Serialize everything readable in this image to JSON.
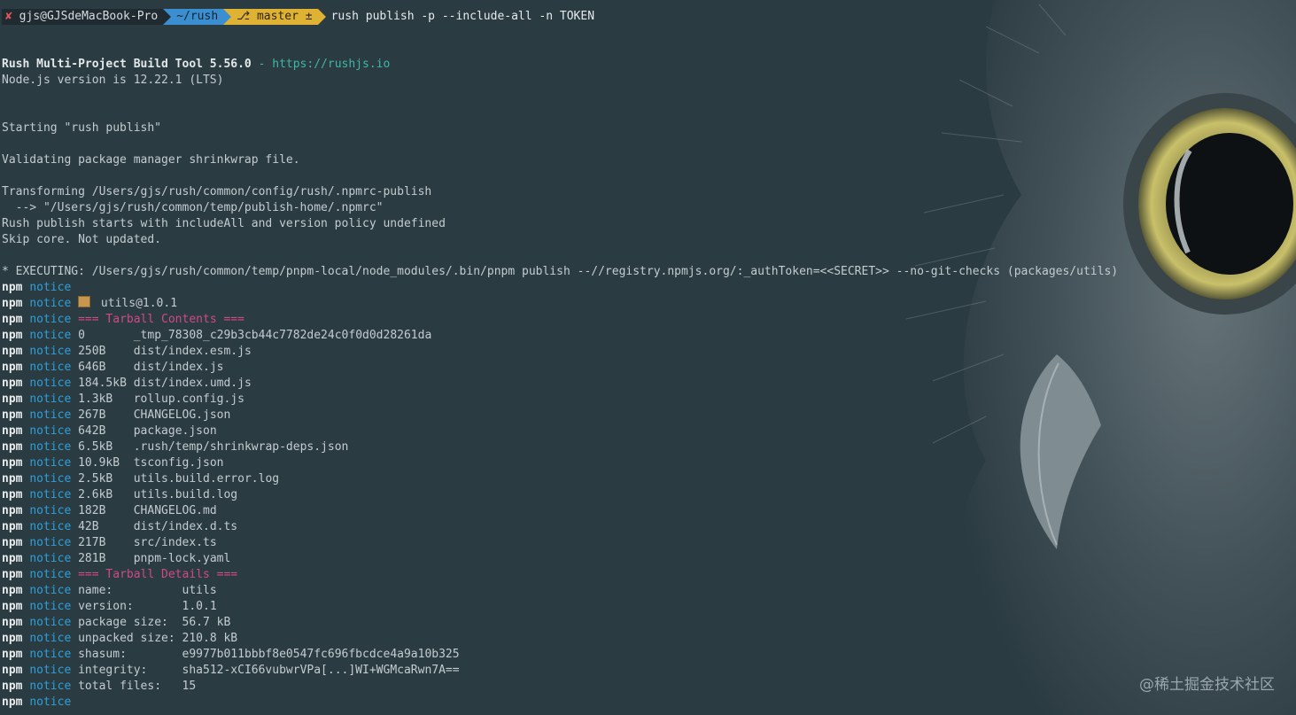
{
  "prompt": {
    "status_icon": "✘",
    "user_host": "gjs@GJSdeMacBook-Pro",
    "dir": "~/rush",
    "branch_icon": "git-branch-icon",
    "branch": "master ±",
    "command": "rush publish -p --include-all -n TOKEN"
  },
  "header": {
    "tool_name": "Rush Multi-Project Build Tool 5.56.0",
    "separator": " - ",
    "url": "https://rushjs.io",
    "node_version": "Node.js version is 12.22.1 (LTS)"
  },
  "log": {
    "starting": "Starting \"rush publish\"",
    "validating": "Validating package manager shrinkwrap file.",
    "transform_1": "Transforming /Users/gjs/rush/common/config/rush/.npmrc-publish",
    "transform_2": "  --> \"/Users/gjs/rush/common/temp/publish-home/.npmrc\"",
    "starts_with": "Rush publish starts with includeAll and version policy undefined",
    "skip_core": "Skip core. Not updated.",
    "executing": "* EXECUTING: /Users/gjs/rush/common/temp/pnpm-local/node_modules/.bin/pnpm publish --//registry.npmjs.org/:_authToken=<<SECRET>> --no-git-checks (packages/utils)"
  },
  "npm": {
    "prefix": "npm",
    "notice": "notice",
    "package_line": " utils@1.0.1",
    "package_icon": "package-icon",
    "tarball_contents_title": "=== Tarball Contents ===",
    "files": [
      {
        "size": "0       ",
        "path": "_tmp_78308_c29b3cb44c7782de24c0f0d0d28261da"
      },
      {
        "size": "250B    ",
        "path": "dist/index.esm.js"
      },
      {
        "size": "646B    ",
        "path": "dist/index.js"
      },
      {
        "size": "184.5kB ",
        "path": "dist/index.umd.js"
      },
      {
        "size": "1.3kB   ",
        "path": "rollup.config.js"
      },
      {
        "size": "267B    ",
        "path": "CHANGELOG.json"
      },
      {
        "size": "642B    ",
        "path": "package.json"
      },
      {
        "size": "6.5kB   ",
        "path": ".rush/temp/shrinkwrap-deps.json"
      },
      {
        "size": "10.9kB  ",
        "path": "tsconfig.json"
      },
      {
        "size": "2.5kB   ",
        "path": "utils.build.error.log"
      },
      {
        "size": "2.6kB   ",
        "path": "utils.build.log"
      },
      {
        "size": "182B    ",
        "path": "CHANGELOG.md"
      },
      {
        "size": "42B     ",
        "path": "dist/index.d.ts"
      },
      {
        "size": "217B    ",
        "path": "src/index.ts"
      },
      {
        "size": "281B    ",
        "path": "pnpm-lock.yaml"
      }
    ],
    "tarball_details_title": "=== Tarball Details ===",
    "details": [
      {
        "key": "name:          ",
        "value": "utils"
      },
      {
        "key": "version:       ",
        "value": "1.0.1"
      },
      {
        "key": "package size:  ",
        "value": "56.7 kB"
      },
      {
        "key": "unpacked size: ",
        "value": "210.8 kB"
      },
      {
        "key": "shasum:        ",
        "value": "e9977b011bbbf8e0547fc696fbcdce4a9a10b325"
      },
      {
        "key": "integrity:     ",
        "value": "sha512-xCI66vubwrVPa[...]WI+WGMcaRwn7A=="
      },
      {
        "key": "total files:   ",
        "value": "15"
      }
    ]
  },
  "watermark": "@稀土掘金技术社区",
  "colors": {
    "background": "#2b3b42",
    "notice": "#2e9fd8",
    "section_title": "#d14a86",
    "link": "#3fb7a6",
    "dir_segment": "#3b8fd1",
    "git_segment": "#e0b233"
  }
}
